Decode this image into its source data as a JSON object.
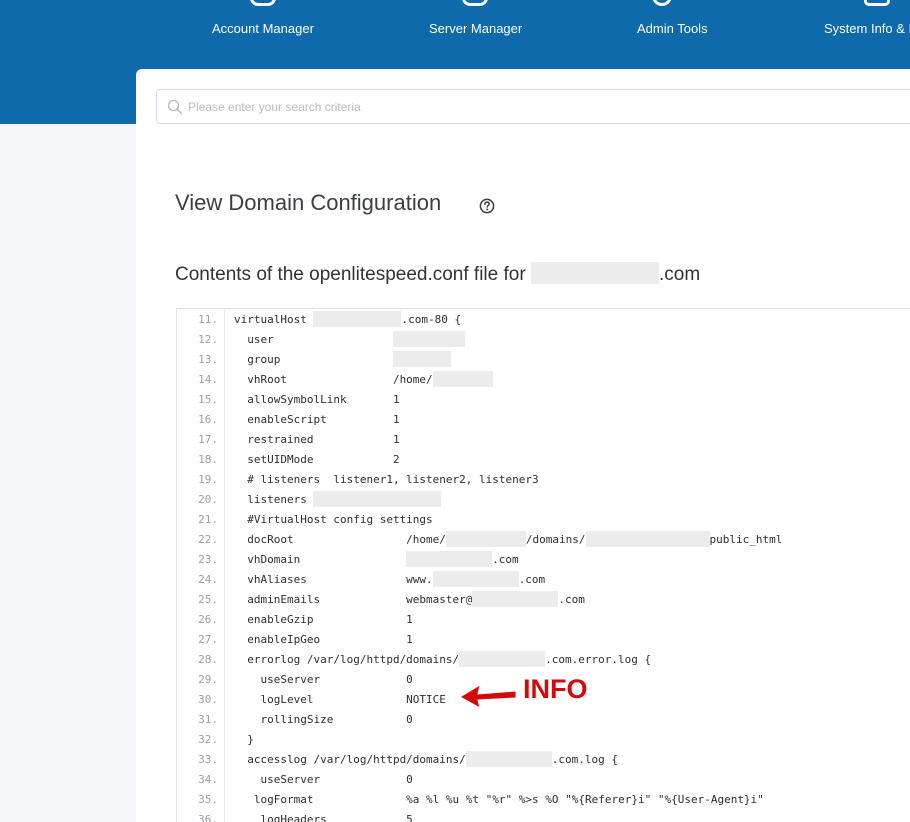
{
  "nav": {
    "items": [
      {
        "label": "Account Manager",
        "icon": "account-icon"
      },
      {
        "label": "Server Manager",
        "icon": "server-icon"
      },
      {
        "label": "Admin Tools",
        "icon": "gear-icon"
      },
      {
        "label": "System Info & I",
        "icon": "system-info-icon"
      }
    ]
  },
  "search": {
    "placeholder": "Please enter your search criteria",
    "value": ""
  },
  "page": {
    "title": "View Domain Configuration"
  },
  "subtitle": {
    "prefix": "Contents of the openlitespeed.conf file for",
    "suffix": ".com"
  },
  "code": {
    "lines": [
      {
        "n": "11.",
        "parts": [
          "virtualHost ",
          "",
          ".com-80 {"
        ]
      },
      {
        "n": "12.",
        "parts": [
          "  user                  ",
          ""
        ]
      },
      {
        "n": "13.",
        "parts": [
          "  group                 ",
          ""
        ]
      },
      {
        "n": "14.",
        "parts": [
          "  vhRoot                /home/",
          ""
        ]
      },
      {
        "n": "15.",
        "parts": [
          "  allowSymbolLink       1"
        ]
      },
      {
        "n": "16.",
        "parts": [
          "  enableScript          1"
        ]
      },
      {
        "n": "17.",
        "parts": [
          "  restrained            1"
        ]
      },
      {
        "n": "18.",
        "parts": [
          "  setUIDMode            2"
        ]
      },
      {
        "n": "19.",
        "parts": [
          "  # listeners  listener1, listener2, listener3"
        ]
      },
      {
        "n": "20.",
        "parts": [
          "  listeners ",
          ""
        ]
      },
      {
        "n": "21.",
        "parts": [
          "  #VirtualHost config settings"
        ]
      },
      {
        "n": "22.",
        "parts": [
          "  docRoot                 /home/",
          "",
          "/domains/",
          "",
          "public_html"
        ]
      },
      {
        "n": "23.",
        "parts": [
          "  vhDomain                ",
          "",
          ".com"
        ]
      },
      {
        "n": "24.",
        "parts": [
          "  vhAliases               www.",
          "",
          ".com"
        ]
      },
      {
        "n": "25.",
        "parts": [
          "  adminEmails             webmaster@",
          "",
          ".com"
        ]
      },
      {
        "n": "26.",
        "parts": [
          "  enableGzip              1"
        ]
      },
      {
        "n": "27.",
        "parts": [
          "  enableIpGeo             1"
        ]
      },
      {
        "n": "28.",
        "parts": [
          "  errorlog /var/log/httpd/domains/",
          "",
          ".com.error.log {"
        ]
      },
      {
        "n": "29.",
        "parts": [
          "    useServer             0"
        ]
      },
      {
        "n": "30.",
        "parts": [
          "    logLevel              NOTICE"
        ]
      },
      {
        "n": "31.",
        "parts": [
          "    rollingSize           0"
        ]
      },
      {
        "n": "32.",
        "parts": [
          "  }"
        ]
      },
      {
        "n": "33.",
        "parts": [
          "  accesslog /var/log/httpd/domains/",
          "",
          ".com.log {"
        ]
      },
      {
        "n": "34.",
        "parts": [
          "    useServer             0"
        ]
      },
      {
        "n": "35.",
        "parts": [
          "   logFormat              %a %l %u %t \"%r\" %>s %O \"%{Referer}i\" \"%{User-Agent}i\""
        ]
      },
      {
        "n": "36.",
        "parts": [
          "    logHeaders            5"
        ]
      }
    ]
  },
  "annotation": {
    "label": "INFO",
    "color": "#d40a0a"
  },
  "colors": {
    "banner": "#0e6aab",
    "panel": "#ffffff",
    "page_bg": "#f4f6f9"
  }
}
